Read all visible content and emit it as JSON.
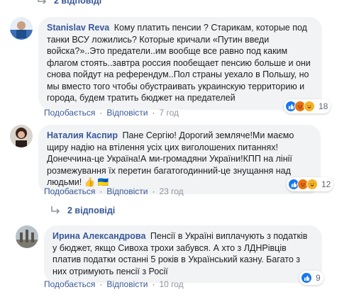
{
  "top_replies": {
    "label": "2 відповіді"
  },
  "comments": [
    {
      "author": "Stanislav Reva",
      "text": "Кому платить пенсии ? Старикам, которые под танки ВСУ ложились? Которые кричали «Путин введи войска?»..Это предатели..им вообще все равно под каким флагом стоять..завтра россия пообещает пенсию больше и они снова пойдут на референдум..Пол страны уехало в Польшу, но мы вместо того чтобы обустраивать украинскую территорию и города, будем тратить бюджет на предателей",
      "reaction_count": "18",
      "like_label": "Подобається",
      "reply_label": "Відповісти",
      "time": "7 год"
    },
    {
      "author": "Наталия Каспир",
      "text": "Пане Сергію! Дорогий земляче!Ми маємо щиру надію на втілення усіх цих виголошених питаннях!Донеччина-це Україна!А ми-громадяни України!КПП на лінії розмежування їх перетин багатогодинний-це знущання над людьми! 👍 🇺🇦",
      "reaction_count": "12",
      "like_label": "Подобається",
      "reply_label": "Відповісти",
      "time": "23 год"
    },
    {
      "author": "Ирина Александрова",
      "text": "Пенсії в Україні виплачують з податків у бюджет, якщо Сивоха трохи забувся. А хто з ЛДНРівців платив податки останні 5 років в Український казну. Багато з них отримують пенсії з Росії",
      "reaction_count": "9",
      "like_label": "Подобається",
      "reply_label": "Відповісти",
      "time": "10 год"
    }
  ],
  "mid_replies": {
    "label": "2 відповіді"
  },
  "colors": {
    "link": "#385898",
    "bubble": "#f2f3f5",
    "like": "#1877f2",
    "haha": "#f7b125",
    "angry": "#e9710f"
  }
}
